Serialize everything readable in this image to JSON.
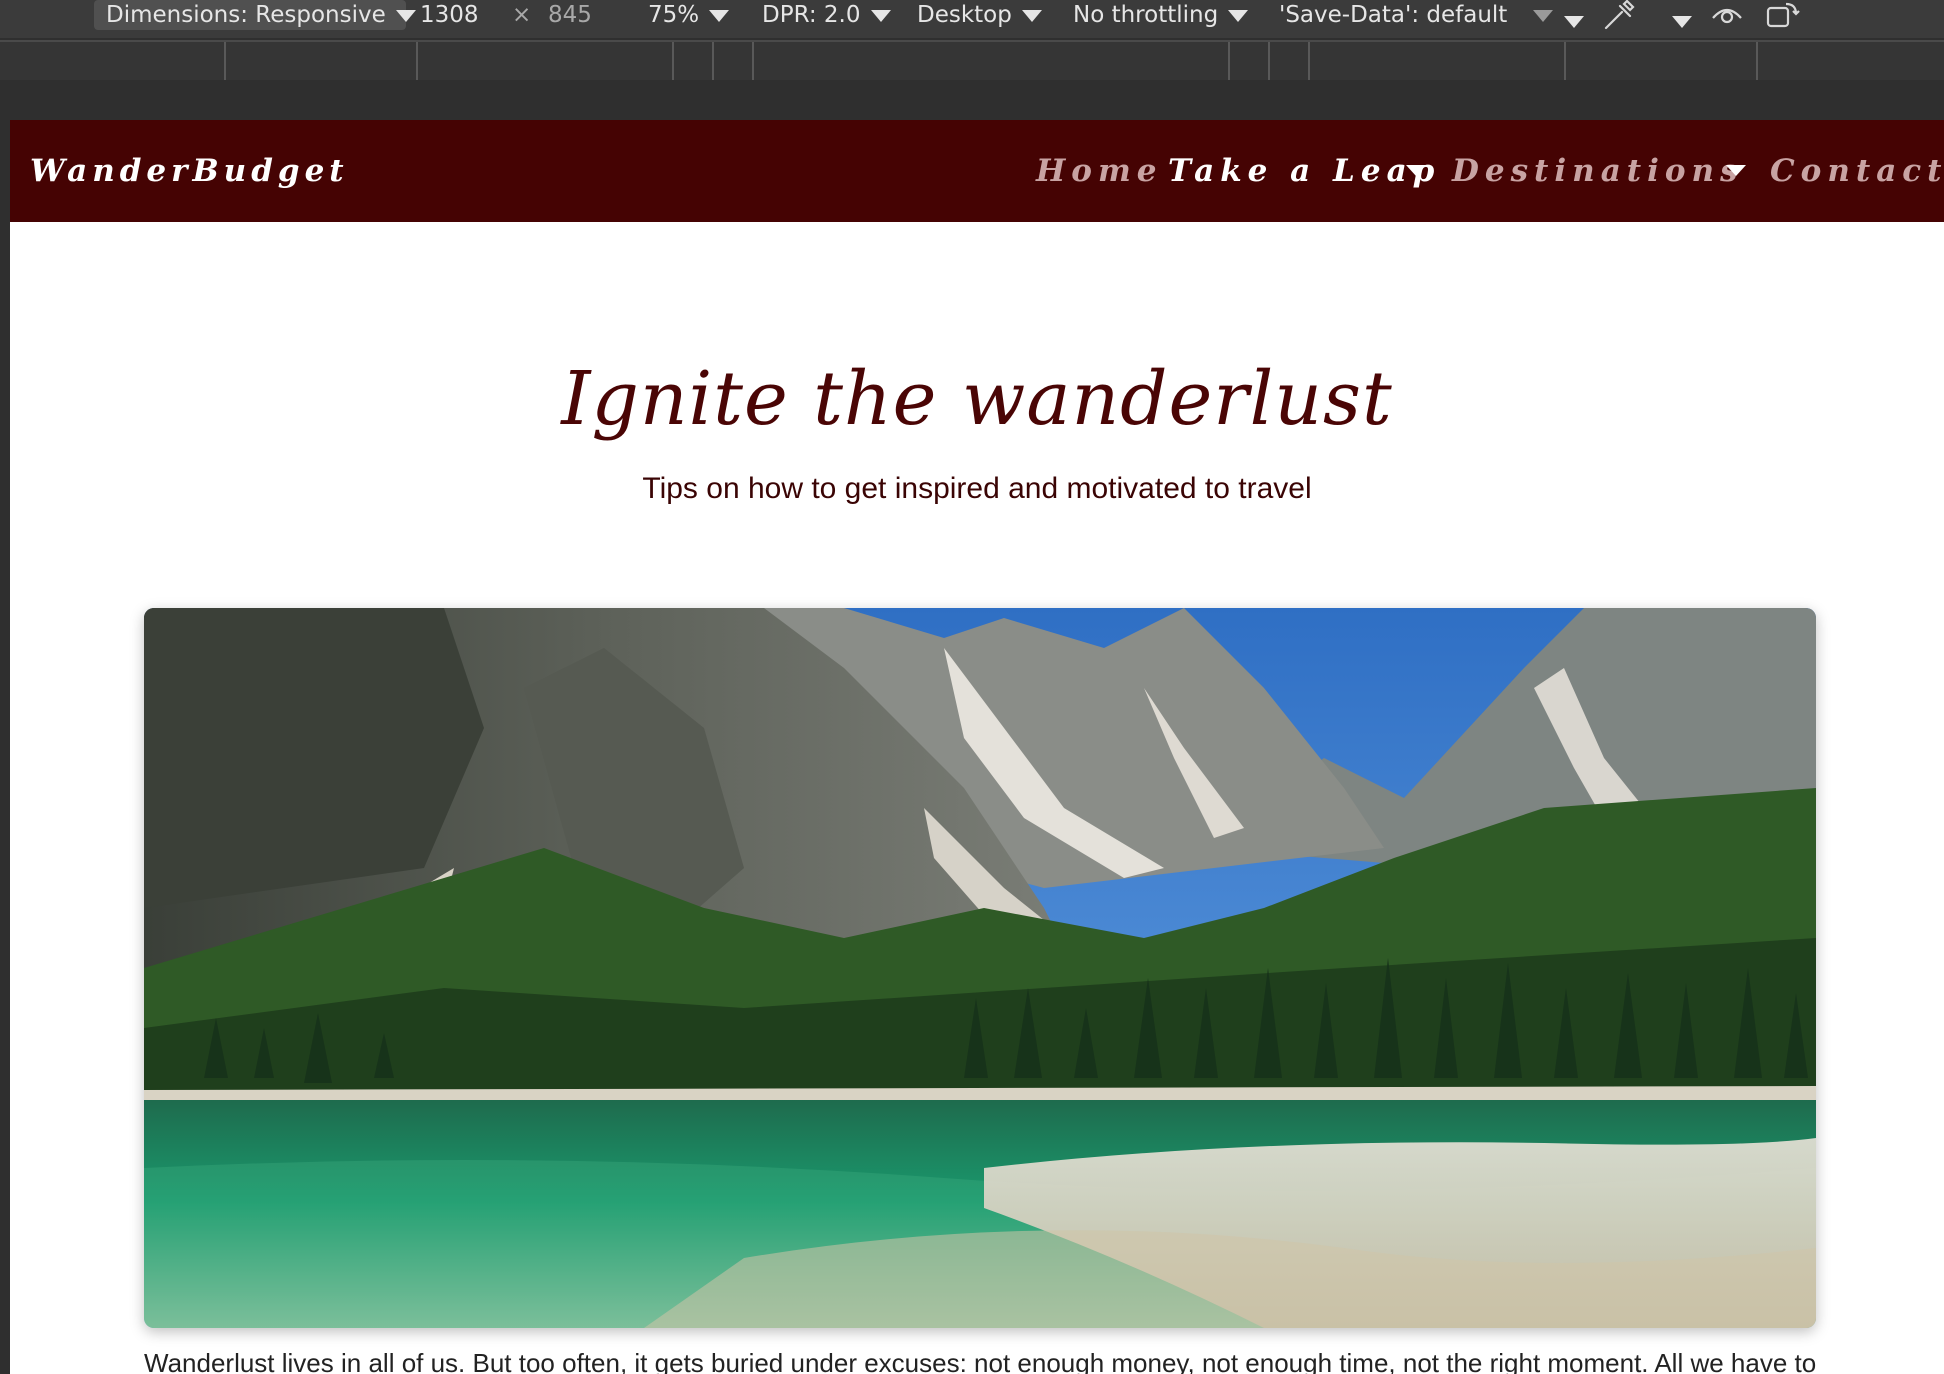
{
  "devtools": {
    "dimensions_label": "Dimensions: Responsive",
    "width_value": "1308",
    "times_symbol": "×",
    "height_value": "845",
    "zoom": "75%",
    "dpr": "DPR: 2.0",
    "device_type": "Desktop",
    "throttling": "No throttling",
    "save_data": "'Save-Data': default"
  },
  "site": {
    "brand": "WanderBudget",
    "nav": [
      {
        "label": "Home",
        "active": false,
        "dropdown": false
      },
      {
        "label": "Take a Leap",
        "active": true,
        "dropdown": true
      },
      {
        "label": "Destinations",
        "active": false,
        "dropdown": true
      },
      {
        "label": "Contact",
        "active": false,
        "dropdown": false
      }
    ],
    "colors": {
      "navbar": "#450303",
      "title": "#4a0505",
      "nav_inactive": "#c8a3a3"
    }
  },
  "hero": {
    "title": "Ignite the wanderlust",
    "subtitle": "Tips on how to get inspired and motivated to travel",
    "image_subject": "mountain-lake-landscape"
  },
  "article": {
    "first_line": "Wanderlust lives in all of us. But too often, it gets buried under excuses: not enough money, not enough time, not the right moment. All we have to"
  }
}
